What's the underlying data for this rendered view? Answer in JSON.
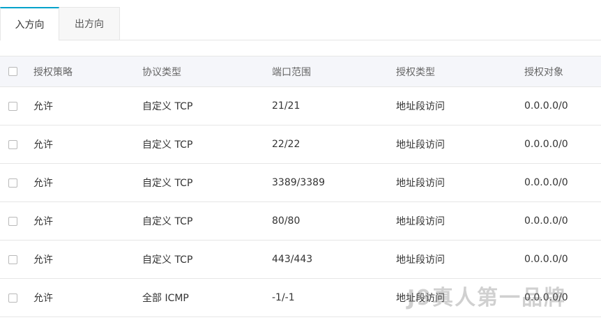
{
  "tabs": [
    {
      "label": "入方向",
      "active": true
    },
    {
      "label": "出方向",
      "active": false
    }
  ],
  "table": {
    "headers": {
      "policy": "授权策略",
      "protocol": "协议类型",
      "port_range": "端口范围",
      "auth_type": "授权类型",
      "auth_object": "授权对象"
    },
    "rows": [
      {
        "policy": "允许",
        "protocol": "自定义 TCP",
        "port_range": "21/21",
        "auth_type": "地址段访问",
        "auth_object": "0.0.0.0/0"
      },
      {
        "policy": "允许",
        "protocol": "自定义 TCP",
        "port_range": "22/22",
        "auth_type": "地址段访问",
        "auth_object": "0.0.0.0/0"
      },
      {
        "policy": "允许",
        "protocol": "自定义 TCP",
        "port_range": "3389/3389",
        "auth_type": "地址段访问",
        "auth_object": "0.0.0.0/0"
      },
      {
        "policy": "允许",
        "protocol": "自定义 TCP",
        "port_range": "80/80",
        "auth_type": "地址段访问",
        "auth_object": "0.0.0.0/0"
      },
      {
        "policy": "允许",
        "protocol": "自定义 TCP",
        "port_range": "443/443",
        "auth_type": "地址段访问",
        "auth_object": "0.0.0.0/0"
      },
      {
        "policy": "允许",
        "protocol": "全部 ICMP",
        "port_range": "-1/-1",
        "auth_type": "地址段访问",
        "auth_object": "0.0.0.0/0"
      }
    ]
  },
  "watermark": "J9真人第一品牌",
  "colors": {
    "tab_active_border": "#00a2ca",
    "header_bg": "#f5f6fa",
    "border": "#e6e6e6"
  }
}
